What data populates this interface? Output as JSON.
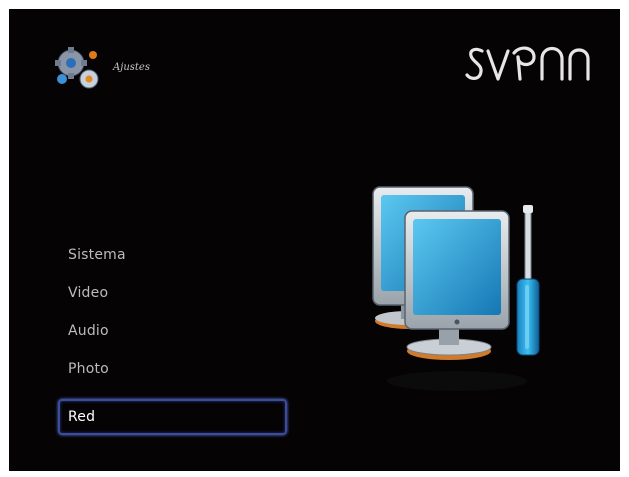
{
  "header": {
    "title": "Ajustes",
    "icon": "gears-icon"
  },
  "brand": {
    "logo_text": "svɐon"
  },
  "menu": {
    "items": [
      {
        "label": "Sistema",
        "selected": false
      },
      {
        "label": "Video",
        "selected": false
      },
      {
        "label": "Audio",
        "selected": false
      },
      {
        "label": "Photo",
        "selected": false
      },
      {
        "label": "Red",
        "selected": true
      }
    ]
  },
  "illustration": {
    "icon": "network-computers-screwdriver-icon"
  },
  "colors": {
    "background": "#050304",
    "menu_text": "#bcbcbc",
    "selected_text": "#ffffff",
    "selection_border": "#3c4d9e",
    "screen_blue": "#2aa8dc",
    "screwdriver_handle": "#1e9fd8"
  }
}
